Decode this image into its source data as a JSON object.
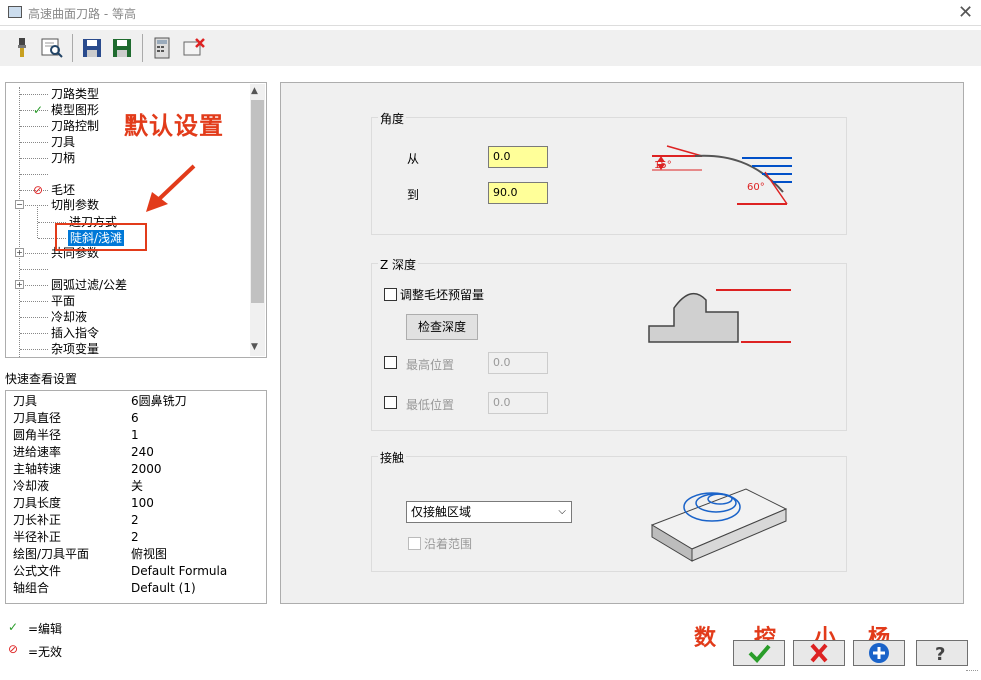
{
  "window": {
    "title": "高速曲面刀路 - 等高"
  },
  "toolbar": {
    "icons": [
      "tool-icon",
      "preview-icon",
      "save-icon",
      "save-all-icon",
      "calculator-icon",
      "delete-icon"
    ]
  },
  "tree": {
    "items": [
      "刀路类型",
      "模型图形",
      "刀路控制",
      "刀具",
      "刀柄",
      "毛坯",
      "切削参数",
      "进刀方式",
      "陡斜/浅滩",
      "共同参数",
      "圆弧过滤/公差",
      "平面",
      "冷却液",
      "插入指令",
      "杂项变量"
    ]
  },
  "annotation": {
    "label": "默认设置",
    "watermark": [
      "数",
      "控",
      "小",
      "杨"
    ]
  },
  "quick": {
    "title": "快速查看设置",
    "rows": [
      {
        "k": "刀具",
        "v": "6圆鼻铣刀"
      },
      {
        "k": "刀具直径",
        "v": "6"
      },
      {
        "k": "圆角半径",
        "v": "1"
      },
      {
        "k": "进给速率",
        "v": "240"
      },
      {
        "k": "主轴转速",
        "v": "2000"
      },
      {
        "k": "冷却液",
        "v": "关"
      },
      {
        "k": "刀具长度",
        "v": "100"
      },
      {
        "k": "刀长补正",
        "v": "2"
      },
      {
        "k": "半径补正",
        "v": "2"
      },
      {
        "k": "绘图/刀具平面",
        "v": "俯视图"
      },
      {
        "k": "公式文件",
        "v": "Default Formula"
      },
      {
        "k": "轴组合",
        "v": "Default (1)"
      }
    ]
  },
  "legend": {
    "edit": "=编辑",
    "invalid": "=无效"
  },
  "angle": {
    "title": "角度",
    "from_label": "从",
    "from_value": "0.0",
    "to_label": "到",
    "to_value": "90.0",
    "fig_a": "15°",
    "fig_b": "60°"
  },
  "zdepth": {
    "title": "Z 深度",
    "adjust_label": "调整毛坯预留量",
    "check_button": "检查深度",
    "top_label": "最高位置",
    "top_value": "0.0",
    "bottom_label": "最低位置",
    "bottom_value": "0.0"
  },
  "contact": {
    "title": "接触",
    "option": "仅接触区域",
    "along_label": "沿着范围"
  },
  "colors": {
    "accent": "#0078d7",
    "red": "#e23b1a",
    "yellow_field": "#ffff99"
  }
}
